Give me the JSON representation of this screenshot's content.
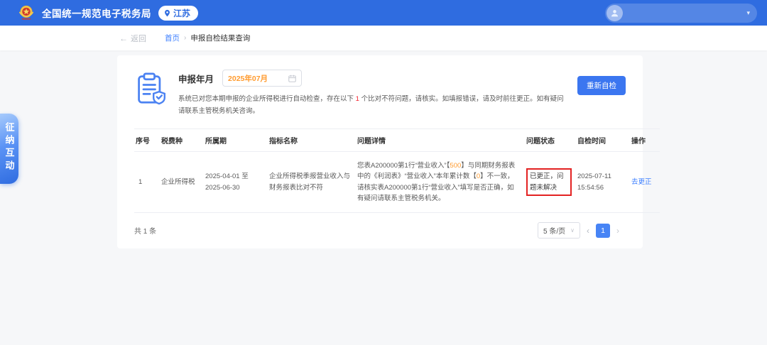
{
  "colors": {
    "header_blue": "#2f6ce0",
    "accent_blue": "#3b76f0",
    "link_blue": "#3d7fff",
    "highlight_orange": "#ff9b2f",
    "alert_red": "#f5222d",
    "annotation_red": "#e32222"
  },
  "header": {
    "app_title": "全国统一规范电子税务局",
    "region_badge": "江苏",
    "user_caret": "▾"
  },
  "breadcrumb": {
    "back_arrow": "←",
    "back_label": "返回",
    "home": "首页",
    "separator": "›",
    "current": "申报自检结果查询"
  },
  "side_tab": {
    "label": "征纳互动"
  },
  "panel": {
    "month_label": "申报年月",
    "month_value": "2025年07月",
    "notice_segments": [
      {
        "t": "系统已对您本期申报的企业所得税进行自动检查，存在以下 "
      },
      {
        "t": "1",
        "c": "#f5222d"
      },
      {
        "t": " 个比对不符问题，请核实。如填报错误，请及时前往更正。如有疑问请联系主管税务机关咨询。"
      }
    ],
    "recheck_button": "重新自检"
  },
  "table": {
    "headers": [
      "序号",
      "税费种",
      "所属期",
      "指标名称",
      "问题详情",
      "问题状态",
      "自检时间",
      "操作"
    ],
    "rows": [
      {
        "index": "1",
        "tax_type": "企业所得税",
        "period": "2025-04-01 至 2025-06-30",
        "indicator": "企业所得税季报营业收入与财务报表比对不符",
        "detail_segments": [
          {
            "t": "您表A200000第1行“营业收入”【"
          },
          {
            "t": "500",
            "c": "#ff9b2f"
          },
          {
            "t": "】与同期财务报表中的《利润表》“营业收入”本年累计数【"
          },
          {
            "t": "0",
            "c": "#ff9b2f"
          },
          {
            "t": "】不一致，请核实表A200000第1行“营业收入”填写是否正确，如有疑问请联系主管税务机关。"
          }
        ],
        "status": "已更正，问题未解决",
        "check_time": "2025-07-11 15:54:56",
        "action": "去更正"
      }
    ]
  },
  "pagination": {
    "total_label": "共 1 条",
    "page_size_label": "5 条/页",
    "page_size_caret": "∨",
    "prev": "‹",
    "page": "1",
    "next": "›"
  }
}
